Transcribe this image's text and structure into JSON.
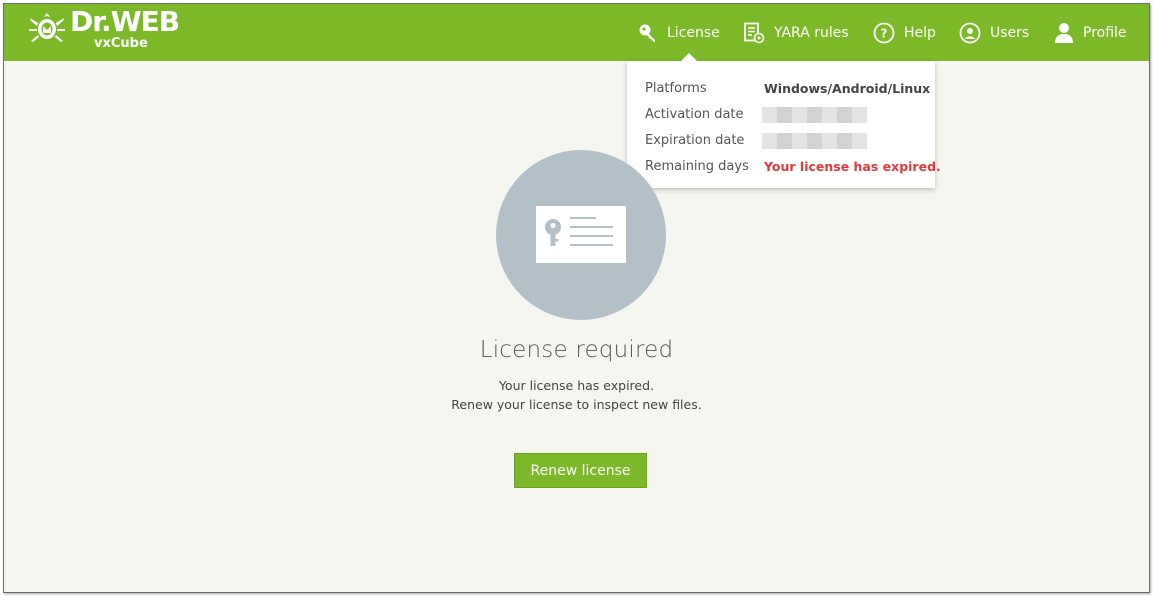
{
  "brand": {
    "title": "Dr.WEB",
    "subtitle": "vxCube",
    "color": "#7cb928"
  },
  "nav": {
    "items": [
      {
        "label": "License",
        "icon": "key-icon"
      },
      {
        "label": "YARA rules",
        "icon": "document-gear-icon"
      },
      {
        "label": "Help",
        "icon": "question-circle-icon"
      },
      {
        "label": "Users",
        "icon": "user-circle-icon"
      },
      {
        "label": "Profile",
        "icon": "person-icon"
      }
    ]
  },
  "license_popup": {
    "rows": [
      {
        "label": "Platforms",
        "value": "Windows/Android/Linux"
      },
      {
        "label": "Activation date",
        "value": null
      },
      {
        "label": "Expiration date",
        "value": null
      },
      {
        "label": "Remaining days",
        "value": "Your license has expired."
      }
    ],
    "alert_color": "#e4393c"
  },
  "main": {
    "icon": "license-card-icon",
    "title": "License required",
    "line1": "Your license has expired.",
    "line2": "Renew your license to inspect new files.",
    "button_label": "Renew license"
  }
}
